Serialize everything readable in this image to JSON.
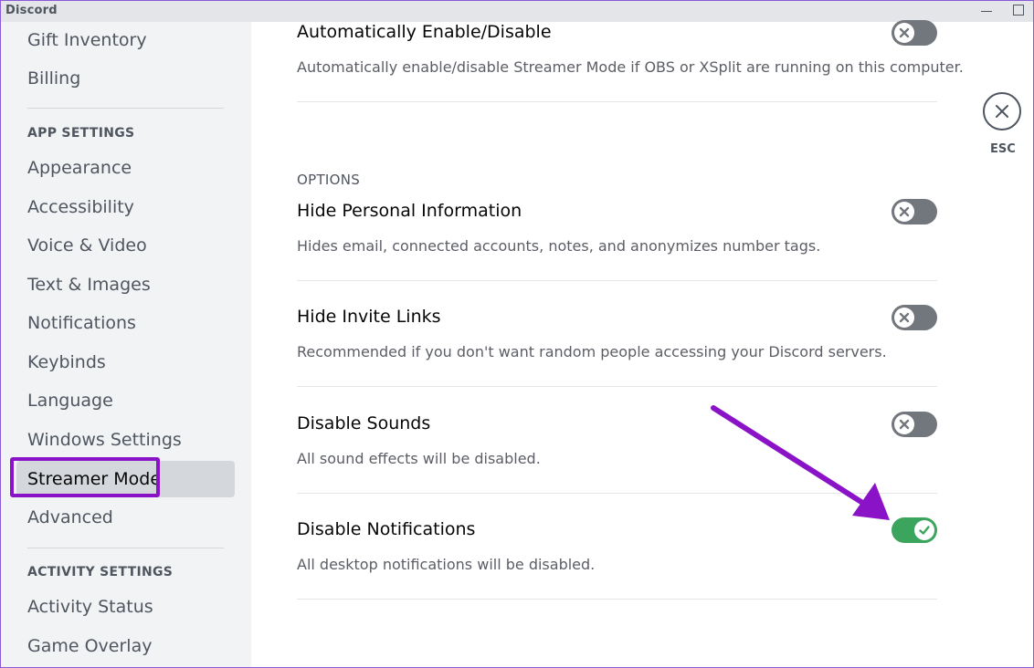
{
  "window": {
    "title": "Discord"
  },
  "sidebar": {
    "items_top": [
      {
        "label": "Gift Inventory"
      },
      {
        "label": "Billing"
      }
    ],
    "app_settings_header": "APP SETTINGS",
    "app_items": [
      {
        "label": "Appearance"
      },
      {
        "label": "Accessibility"
      },
      {
        "label": "Voice & Video"
      },
      {
        "label": "Text & Images"
      },
      {
        "label": "Notifications"
      },
      {
        "label": "Keybinds"
      },
      {
        "label": "Language"
      },
      {
        "label": "Windows Settings"
      },
      {
        "label": "Streamer Mode",
        "selected": true
      },
      {
        "label": "Advanced"
      }
    ],
    "activity_settings_header": "ACTIVITY SETTINGS",
    "activity_items": [
      {
        "label": "Activity Status"
      },
      {
        "label": "Game Overlay"
      }
    ]
  },
  "content": {
    "auto": {
      "title": "Automatically Enable/Disable",
      "desc": "Automatically enable/disable Streamer Mode if OBS or XSplit are running on this computer.",
      "enabled": false
    },
    "options_label": "OPTIONS",
    "options": [
      {
        "title": "Hide Personal Information",
        "desc": "Hides email, connected accounts, notes, and anonymizes number tags.",
        "enabled": false
      },
      {
        "title": "Hide Invite Links",
        "desc": "Recommended if you don't want random people accessing your Discord servers.",
        "enabled": false
      },
      {
        "title": "Disable Sounds",
        "desc": "All sound effects will be disabled.",
        "enabled": false
      },
      {
        "title": "Disable Notifications",
        "desc": "All desktop notifications will be disabled.",
        "enabled": true
      }
    ]
  },
  "close": {
    "label": "ESC"
  },
  "colors": {
    "toggle_off": "#72767d",
    "toggle_on": "#3ba55d",
    "annotation": "#8b13c7"
  },
  "icons": {
    "toggle_off": "x-icon",
    "toggle_on": "check-icon",
    "close": "close-icon"
  }
}
